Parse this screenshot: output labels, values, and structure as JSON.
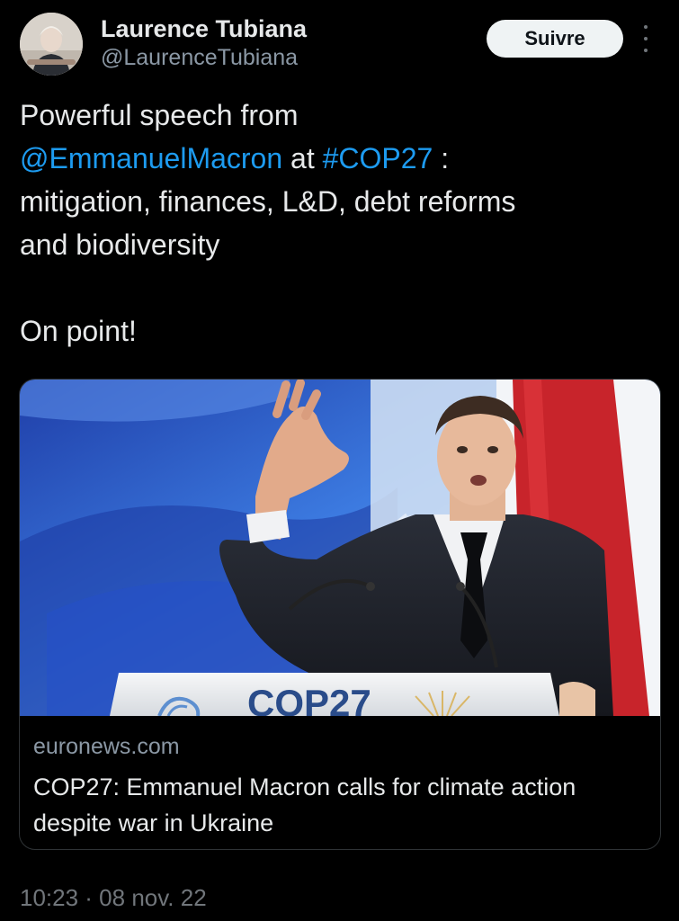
{
  "author": {
    "display_name": "Laurence Tubiana",
    "handle": "@LaurenceTubiana"
  },
  "follow_button": {
    "label": "Suivre"
  },
  "tweet": {
    "line1": "Powerful speech from",
    "mention": "@EmmanuelMacron",
    "at_word": " at ",
    "hashtag": "#COP27",
    "after_hashtag": " :",
    "line3": "mitigation, finances, L&D, debt reforms",
    "line4": "and biodiversity",
    "line5": "On point!"
  },
  "card": {
    "domain": "euronews.com",
    "title": "COP27: Emmanuel Macron calls for climate action despite war in Ukraine",
    "podium_text": "COP27"
  },
  "timestamp": "10:23 · 08 nov. 22",
  "colors": {
    "background": "#000000",
    "text": "#e7e9ea",
    "secondary_text": "#8b98a5",
    "link": "#1d9bf0",
    "follow_button_bg": "#eff3f4"
  }
}
